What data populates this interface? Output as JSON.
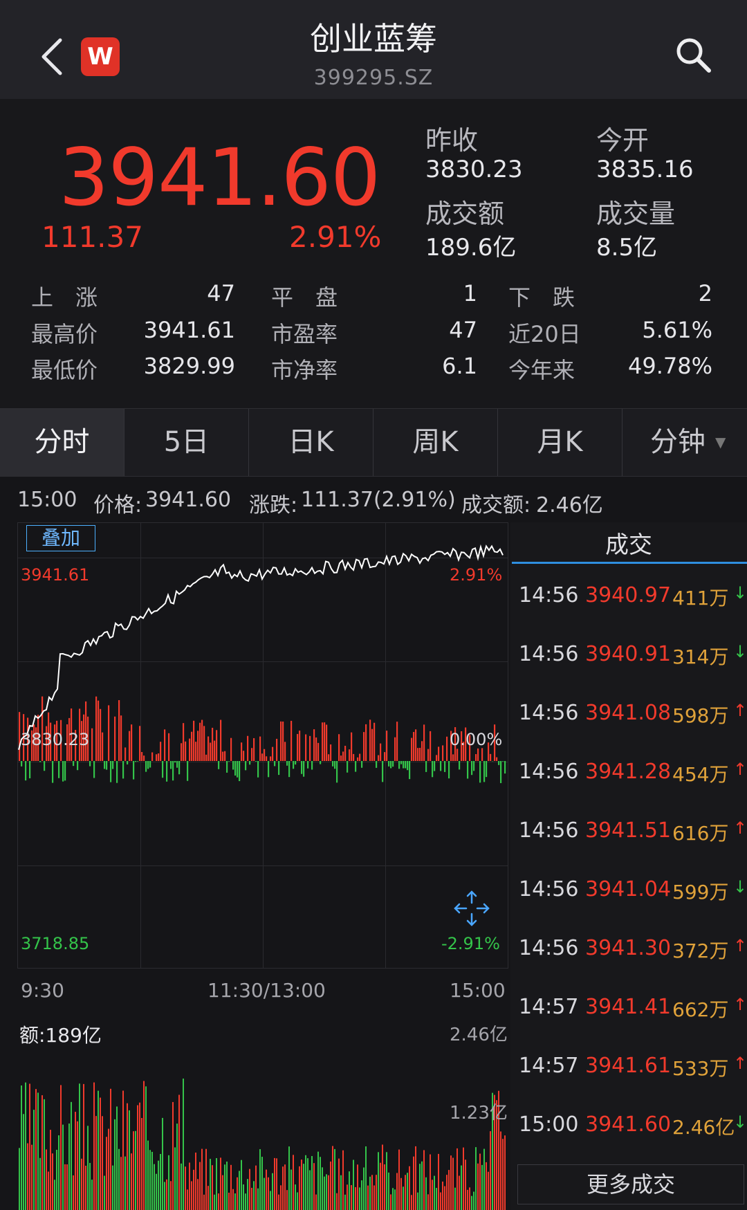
{
  "header": {
    "title": "创业蓝筹",
    "code": "399295.SZ",
    "logo_text": "W"
  },
  "quote": {
    "price": "3941.60",
    "change": "111.37",
    "change_pct": "2.91%",
    "prev_close_label": "昨收",
    "prev_close": "3830.23",
    "open_label": "今开",
    "open": "3835.16",
    "turnover_label": "成交额",
    "turnover": "189.6亿",
    "volume_label": "成交量",
    "volume": "8.5亿"
  },
  "stats": {
    "rise_label": "上　涨",
    "rise": "47",
    "flat_label": "平　盘",
    "flat": "1",
    "fall_label": "下　跌",
    "fall": "2",
    "high_label": "最高价",
    "high": "3941.61",
    "pe_label": "市盈率",
    "pe": "47",
    "d20_label": "近20日",
    "d20": "5.61%",
    "low_label": "最低价",
    "low": "3829.99",
    "pb_label": "市净率",
    "pb": "6.1",
    "ytd_label": "今年来",
    "ytd": "49.78%"
  },
  "tabs": [
    "分时",
    "5日",
    "日K",
    "周K",
    "月K",
    "分钟"
  ],
  "info_bar": {
    "time": "15:00",
    "price_label": "价格:",
    "price": "3941.60",
    "change_label": "涨跌:",
    "change": "111.37(2.91%)",
    "amount_label": "成交额:",
    "amount": "2.46亿"
  },
  "chart": {
    "overlay_button": "叠加",
    "top_value": "3941.61",
    "top_pct": "2.91%",
    "mid_value": "3830.23",
    "mid_pct": "0.00%",
    "bottom_value": "3718.85",
    "bottom_pct": "-2.91%",
    "time_start": "9:30",
    "time_mid": "11:30/13:00",
    "time_end": "15:00",
    "volume_title": "额:189亿",
    "vol_max": "2.46亿",
    "vol_mid": "1.23亿",
    "colors": {
      "up": "#f13a2c",
      "down": "#34c44a",
      "line": "#ffffff"
    }
  },
  "trades": {
    "title": "成交",
    "rows": [
      {
        "time": "14:56",
        "price": "3940.97",
        "vol": "411万",
        "dir": "down"
      },
      {
        "time": "14:56",
        "price": "3940.91",
        "vol": "314万",
        "dir": "down"
      },
      {
        "time": "14:56",
        "price": "3941.08",
        "vol": "598万",
        "dir": "up"
      },
      {
        "time": "14:56",
        "price": "3941.28",
        "vol": "454万",
        "dir": "up"
      },
      {
        "time": "14:56",
        "price": "3941.51",
        "vol": "616万",
        "dir": "up"
      },
      {
        "time": "14:56",
        "price": "3941.04",
        "vol": "599万",
        "dir": "down"
      },
      {
        "time": "14:56",
        "price": "3941.30",
        "vol": "372万",
        "dir": "up"
      },
      {
        "time": "14:57",
        "price": "3941.41",
        "vol": "662万",
        "dir": "up"
      },
      {
        "time": "14:57",
        "price": "3941.61",
        "vol": "533万",
        "dir": "up"
      },
      {
        "time": "15:00",
        "price": "3941.60",
        "vol": "2.46亿",
        "dir": "down"
      }
    ],
    "more_button": "更多成交"
  },
  "icons": {
    "back": "back-icon",
    "search": "search-icon",
    "expand": "expand-icon",
    "dropdown": "dropdown-arrow-icon"
  }
}
